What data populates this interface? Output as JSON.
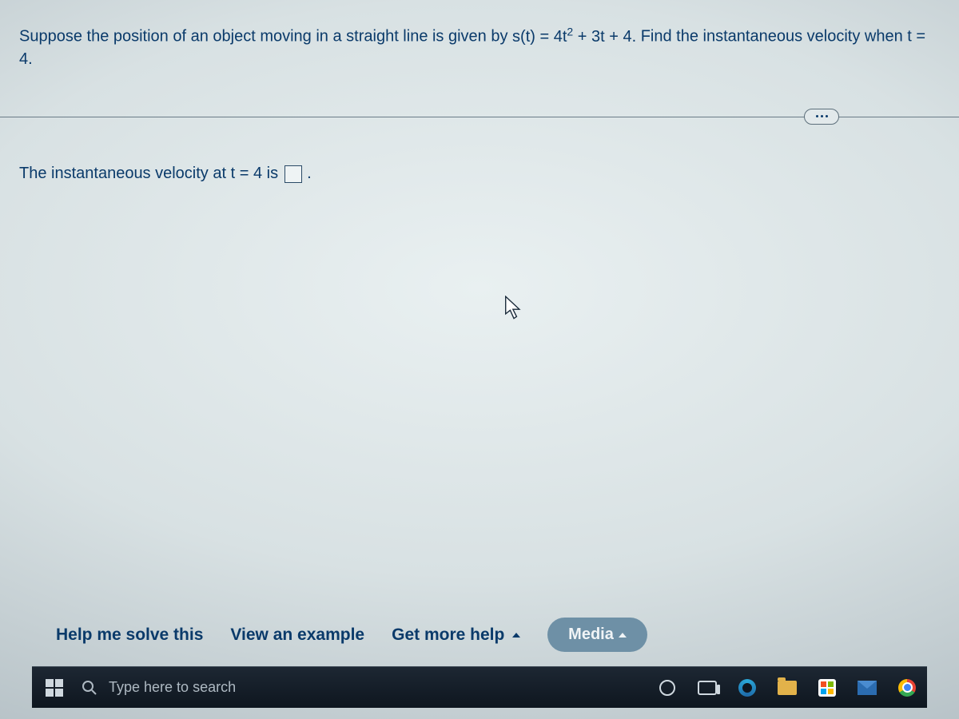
{
  "question": {
    "prefix": "Suppose the position of an object moving in a straight line is given by ",
    "formula_lhs": "s(t) = 4t",
    "formula_exp": "2",
    "formula_rhs": " + 3t + 4.",
    "suffix": "  Find the instantaneous velocity when t = 4."
  },
  "answer": {
    "prefix": "The instantaneous velocity at t = 4 is ",
    "suffix": "."
  },
  "helpbar": {
    "solve": "Help me solve this",
    "example": "View an example",
    "more_help": "Get more help",
    "media": "Media"
  },
  "taskbar": {
    "search_placeholder": "Type here to search"
  }
}
